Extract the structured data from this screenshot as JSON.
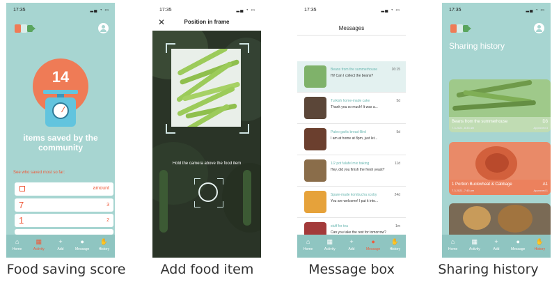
{
  "screens": {
    "score": {
      "time": "17:35",
      "count": "14",
      "saved_text": "items saved by the community",
      "see_who": "See who saved most so far:",
      "header_label": "amount",
      "rows": [
        {
          "rank": "7",
          "value": "3"
        },
        {
          "rank": "1",
          "value": "2"
        }
      ]
    },
    "camera": {
      "time": "17:35",
      "title": "Position in frame",
      "hint": "Hold the camera above the food item"
    },
    "messages": {
      "time": "17:35",
      "title": "Messages",
      "items": [
        {
          "name": "Beans from the summerhouse",
          "text": "Hi! Can I collect the beans?",
          "time": "16:15",
          "unread": true
        },
        {
          "name": "Turkish home-made cake",
          "text": "Thank you so much! It was a...",
          "time": "5d",
          "unread": false
        },
        {
          "name": "Paleo garlic bread-Bird",
          "text": "I am at home at 8pm, just let...",
          "time": "5d",
          "unread": false
        },
        {
          "name": "1/2 pot falafel mix baking",
          "text": "Hey, did you finish the fresh yeast?",
          "time": "11d",
          "unread": false
        },
        {
          "name": "Spare-made kombucha scoby",
          "text": "You are welcome! I put it into...",
          "time": "24d",
          "unread": false
        },
        {
          "name": "stuff for tea",
          "text": "Can you take the rest for tomorrow?",
          "time": "1m",
          "unread": false
        }
      ]
    },
    "history": {
      "time": "17:35",
      "title": "Sharing history",
      "cards": [
        {
          "caption": "Beans from the summerhouse",
          "code": "D3",
          "meta": "7.3.2021, 8:33 am",
          "meta2": "Approved 3"
        },
        {
          "caption": "1 Portion Buckwheat & Cabbage",
          "code": "A1",
          "meta": "7.3.2021, 7:45 pm",
          "meta2": "Approved 1"
        },
        {
          "caption": "",
          "code": "",
          "meta": "",
          "meta2": ""
        }
      ]
    }
  },
  "nav": {
    "items": [
      {
        "label": "Home",
        "icon": "home-icon"
      },
      {
        "label": "Activity",
        "icon": "chart-icon"
      },
      {
        "label": "Add",
        "icon": "plus-icon"
      },
      {
        "label": "Message",
        "icon": "chat-icon"
      },
      {
        "label": "History",
        "icon": "hand-icon"
      }
    ]
  },
  "captions": {
    "score": "Food saving score",
    "camera": "Add food item",
    "messages": "Message box",
    "history": "Sharing history"
  },
  "colors": {
    "teal": "#a7d5d1",
    "accent": "#ef7b56",
    "nav": "#8fc5c1"
  }
}
